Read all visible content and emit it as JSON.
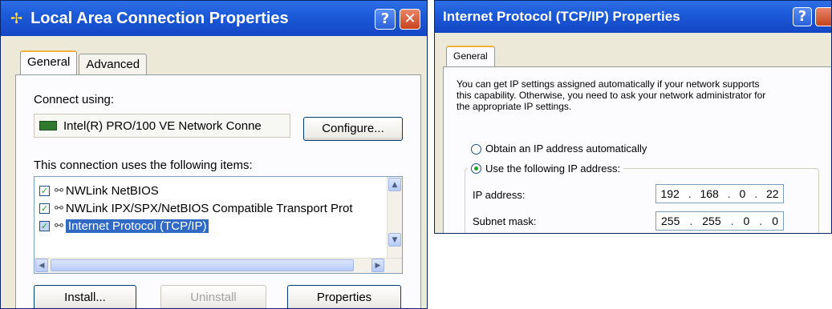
{
  "left_window": {
    "title": "Local Area Connection Properties",
    "help_button": "?",
    "close_button": "✕",
    "tabs": [
      "General",
      "Advanced"
    ],
    "connect_using_label": "Connect using:",
    "adapter_name": "Intel(R) PRO/100 VE Network Conne",
    "configure_button": "Configure...",
    "items_label": "This connection uses the following items:",
    "items": [
      {
        "label": "NWLink NetBIOS",
        "checked": true,
        "selected": false
      },
      {
        "label": "NWLink IPX/SPX/NetBIOS Compatible Transport Prot",
        "checked": true,
        "selected": false
      },
      {
        "label": "Internet Protocol (TCP/IP)",
        "checked": true,
        "selected": true
      }
    ],
    "buttons": {
      "install": "Install...",
      "uninstall": "Uninstall",
      "properties": "Properties"
    }
  },
  "right_window": {
    "title": "Internet Protocol (TCP/IP) Properties",
    "help_button": "?",
    "tab": "General",
    "description": [
      "You can get IP settings assigned automatically if your network supports",
      "this capability. Otherwise, you need to ask your network administrator for",
      "the appropriate IP settings."
    ],
    "radio_auto": {
      "label": "Obtain an IP address automatically",
      "selected": false
    },
    "radio_manual": {
      "label": "Use the following IP address:",
      "selected": true
    },
    "ip_address": {
      "label": "IP address:",
      "octets": [
        "192",
        "168",
        "0",
        "22"
      ]
    },
    "subnet_mask": {
      "label": "Subnet mask:",
      "octets": [
        "255",
        "255",
        "0",
        "0"
      ]
    }
  },
  "colors": {
    "title_bar": "#1c5bd8",
    "selection": "#316ac5",
    "window_bg": "#ece9d8",
    "check": "#21a121"
  }
}
